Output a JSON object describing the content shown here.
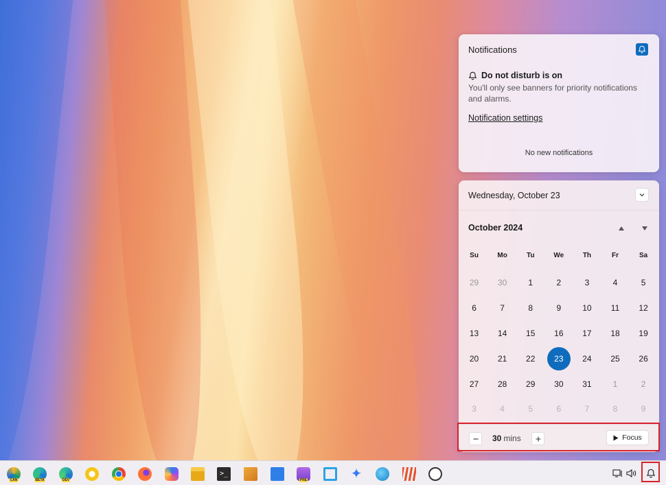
{
  "notifications": {
    "title": "Notifications",
    "dnd_heading": "Do not disturb is on",
    "dnd_description": "You'll only see banners for priority notifications and alarms.",
    "settings_link": "Notification settings",
    "empty_text": "No new notifications"
  },
  "calendar": {
    "full_date": "Wednesday, October 23",
    "month_label": "October 2024",
    "weekdays": [
      "Su",
      "Mo",
      "Tu",
      "We",
      "Th",
      "Fr",
      "Sa"
    ],
    "weeks": [
      [
        "29",
        "30",
        "1",
        "2",
        "3",
        "4",
        "5"
      ],
      [
        "6",
        "7",
        "8",
        "9",
        "10",
        "11",
        "12"
      ],
      [
        "13",
        "14",
        "15",
        "16",
        "17",
        "18",
        "19"
      ],
      [
        "20",
        "21",
        "22",
        "23",
        "24",
        "25",
        "26"
      ],
      [
        "27",
        "28",
        "29",
        "30",
        "31",
        "1",
        "2"
      ],
      [
        "3",
        "4",
        "5",
        "6",
        "7",
        "8",
        "9"
      ]
    ],
    "today": "23",
    "accent_color": "#0f6cbd"
  },
  "focus": {
    "duration_value": "30",
    "duration_unit": "mins",
    "start_label": "Focus"
  },
  "taskbar": {
    "apps": [
      {
        "name": "edge-canary-icon",
        "badge": "CAN"
      },
      {
        "name": "edge-beta-icon",
        "badge": "BETA"
      },
      {
        "name": "edge-dev-icon",
        "badge": "DEV"
      },
      {
        "name": "chrome-canary-icon",
        "badge": ""
      },
      {
        "name": "chrome-icon",
        "badge": ""
      },
      {
        "name": "firefox-icon",
        "badge": ""
      },
      {
        "name": "copilot-icon",
        "badge": ""
      },
      {
        "name": "file-explorer-icon",
        "badge": ""
      },
      {
        "name": "terminal-icon",
        "badge": ""
      },
      {
        "name": "notepad-icon",
        "badge": ""
      },
      {
        "name": "document-icon",
        "badge": ""
      },
      {
        "name": "home-pre-icon",
        "badge": "PRE"
      },
      {
        "name": "snipping-tool-icon",
        "badge": ""
      },
      {
        "name": "sparkle-icon",
        "badge": ""
      },
      {
        "name": "globe-icon",
        "badge": ""
      },
      {
        "name": "app-w-icon",
        "badge": ""
      },
      {
        "name": "clock-icon",
        "badge": ""
      }
    ],
    "tray": [
      "network-icon",
      "volume-icon",
      "do-not-disturb-bell-icon"
    ]
  }
}
